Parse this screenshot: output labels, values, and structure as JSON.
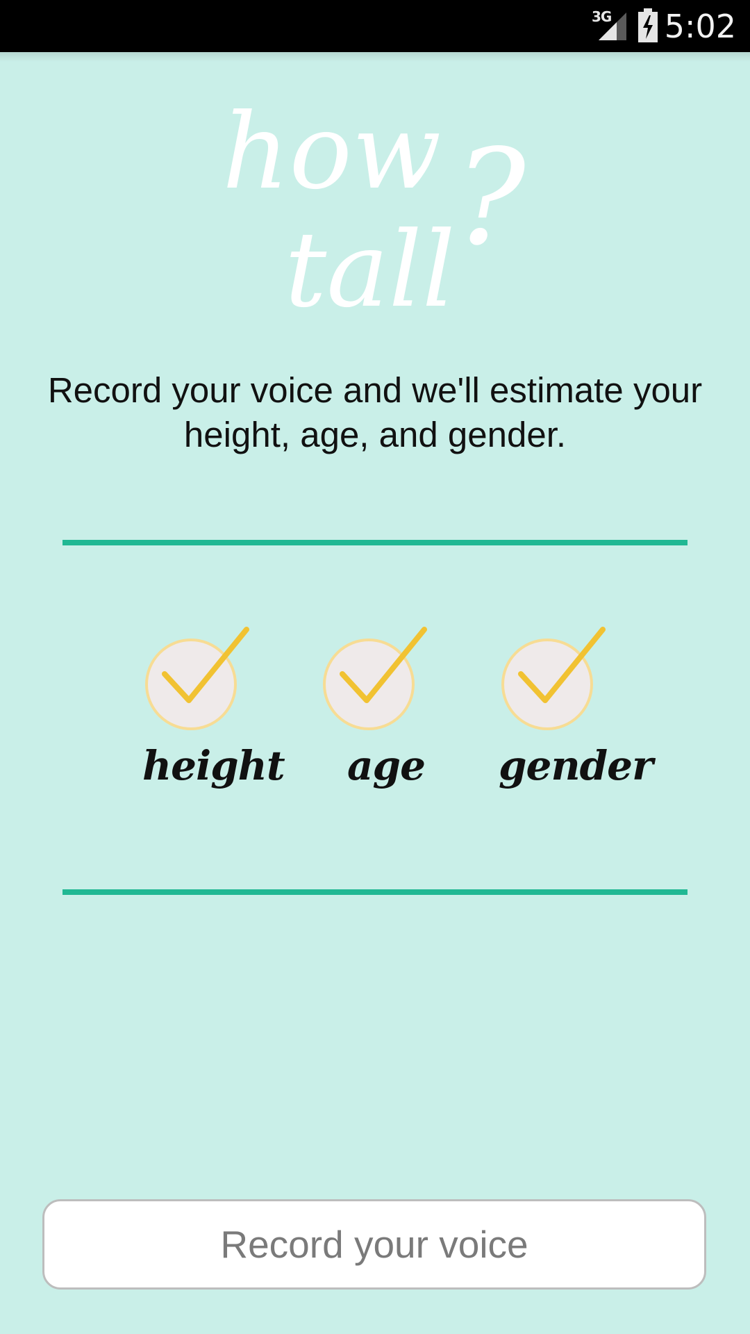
{
  "status_bar": {
    "network": "3G",
    "time": "5:02"
  },
  "logo": {
    "line1": "how",
    "line2": "tall",
    "mark": "?"
  },
  "tagline": "Record your voice and we'll estimate your height, age, and gender.",
  "features": [
    {
      "label": "height",
      "icon": "checkmark-icon"
    },
    {
      "label": "age",
      "icon": "checkmark-icon"
    },
    {
      "label": "gender",
      "icon": "checkmark-icon"
    }
  ],
  "record_button": {
    "label": "Record your voice"
  },
  "colors": {
    "background": "#c9efe8",
    "divider": "#20b893",
    "check": "#f1c232",
    "circle": "#efeaea",
    "circle_border": "#f7dc94"
  }
}
